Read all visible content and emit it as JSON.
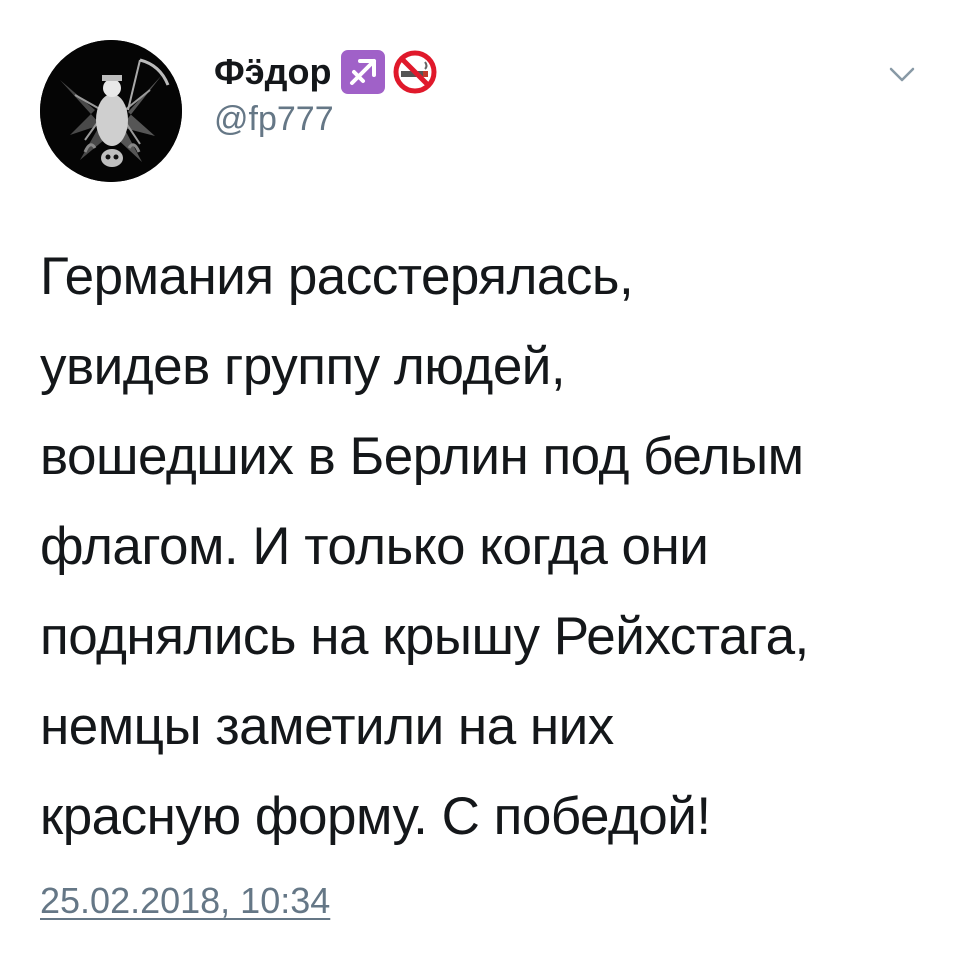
{
  "tweet": {
    "author": {
      "display_name": "Фӭдор",
      "handle": "@fp777",
      "badges": [
        "sagittarius-icon",
        "no-smoking-icon"
      ],
      "avatar": "dark-skull-figure-avatar"
    },
    "menu": "chevron-down-icon",
    "text": "Германия расстерялась,\nувидев группу людей,\nвошедших в Берлин под белым\nфлагом. И только когда они\nподнялись на крышу Рейхстага,\nнемцы заметили на них\nкрасную форму. С победой!",
    "timestamp": "25.02.2018, 10:34"
  },
  "colors": {
    "text": "#14171a",
    "secondary": "#657786",
    "sagittarius_badge": "#a061c8",
    "no_smoking_red": "#e0192b"
  }
}
